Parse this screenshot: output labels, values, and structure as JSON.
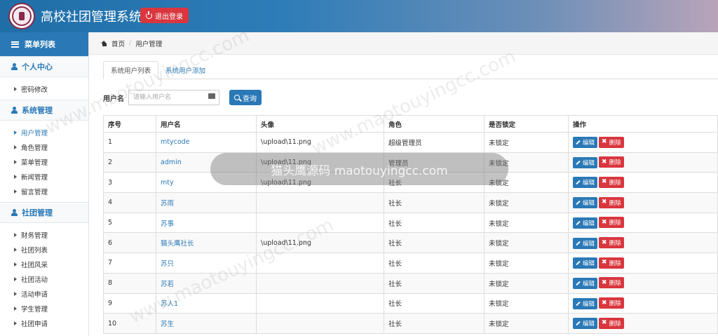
{
  "header": {
    "title": "高校社团管理系统",
    "logout_label": "退出登录"
  },
  "sidebar": {
    "menu_title": "菜单列表",
    "groups": [
      {
        "title": "个人中心",
        "items": [
          "密码修改"
        ]
      },
      {
        "title": "系统管理",
        "items": [
          "用户管理",
          "角色管理",
          "菜单管理",
          "新闻管理",
          "留言管理"
        ]
      },
      {
        "title": "社团管理",
        "items": [
          "财务管理",
          "社团列表",
          "社团风采",
          "社团活动",
          "活动申请",
          "学生管理",
          "社团申请"
        ]
      }
    ]
  },
  "breadcrumb": {
    "home": "首页",
    "current": "用户管理"
  },
  "tabs": [
    "系统用户列表",
    "系统用户添加"
  ],
  "search": {
    "label": "用户名",
    "placeholder": "请输入用户名",
    "button": "查询"
  },
  "table": {
    "headers": [
      "序号",
      "用户名",
      "头像",
      "角色",
      "是否锁定",
      "操作"
    ],
    "edit_label": "编辑",
    "delete_label": "删除",
    "rows": [
      [
        "1",
        "mtycode",
        "\\upload\\11.png",
        "超级管理员",
        "未锁定"
      ],
      [
        "2",
        "admin",
        "\\upload\\11.png",
        "管理员",
        "未锁定"
      ],
      [
        "3",
        "mty",
        "\\upload\\11.png",
        "社长",
        "未锁定"
      ],
      [
        "4",
        "苏雨",
        "",
        "社长",
        "未锁定"
      ],
      [
        "5",
        "苏事",
        "",
        "社长",
        "未锁定"
      ],
      [
        "6",
        "猫头鹰社长",
        "\\upload\\11.png",
        "社长",
        "未锁定"
      ],
      [
        "7",
        "苏只",
        "",
        "社长",
        "未锁定"
      ],
      [
        "8",
        "苏若",
        "",
        "社长",
        "未锁定"
      ],
      [
        "9",
        "苏人1",
        "",
        "社长",
        "未锁定"
      ],
      [
        "10",
        "苏生",
        "",
        "社长",
        "未锁定"
      ]
    ]
  },
  "watermark": {
    "text": "猫头鹰源码 maotouyingcc.com",
    "diag": "www.maotouyingcc.com"
  },
  "colors": {
    "primary": "#2a79b6",
    "danger": "#d9363e"
  }
}
